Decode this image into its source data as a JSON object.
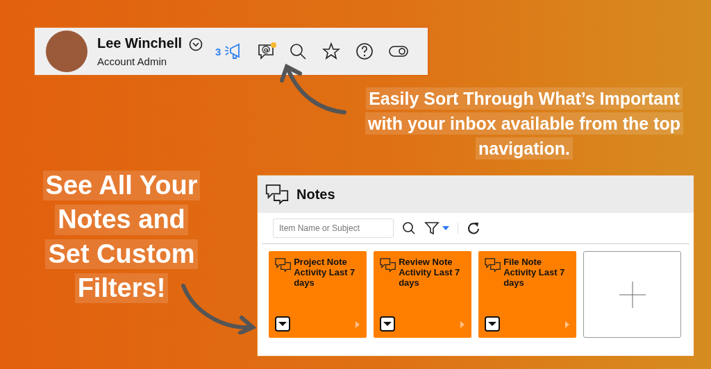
{
  "top_bar": {
    "user_name": "Lee Winchell",
    "user_role": "Account Admin",
    "announcement_count": "3",
    "inbox_unread": true
  },
  "callout_top": {
    "lines": [
      "Easily Sort Through What’s Important",
      "with your inbox available from the top",
      "navigation."
    ]
  },
  "callout_left": {
    "lines": [
      "See All Your",
      "Notes and",
      "Set Custom",
      "Filters!"
    ]
  },
  "notes_panel": {
    "title": "Notes",
    "search": {
      "placeholder": "Item Name or Subject"
    },
    "cards": [
      {
        "kind": "note",
        "title": "Project Note Activity Last 7 days"
      },
      {
        "kind": "note",
        "title": "Review Note Activity Last 7 days"
      },
      {
        "kind": "note",
        "title": "File Note Activity Last 7 days"
      },
      {
        "kind": "add"
      }
    ]
  }
}
